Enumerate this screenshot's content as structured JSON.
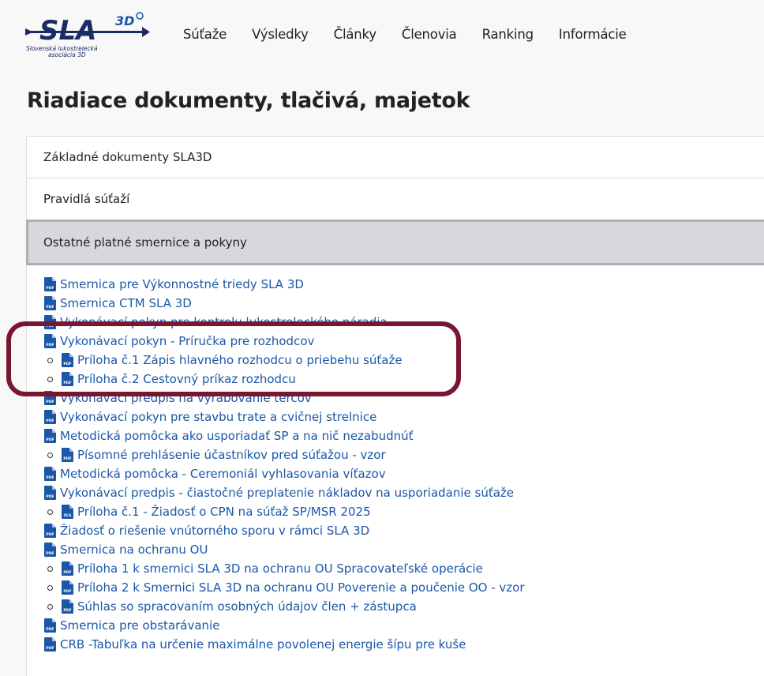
{
  "brand": {
    "logo_text": "SLA",
    "logo_superscript": "3D",
    "tagline_line1": "Slovenská lukostrelecká",
    "tagline_line2": "asociácia 3D",
    "color_primary": "#1a2c63",
    "color_accent": "#1a57a8"
  },
  "nav": {
    "items": [
      "Súťaže",
      "Výsledky",
      "Články",
      "Členovia",
      "Ranking",
      "Informácie"
    ]
  },
  "page": {
    "title": "Riadiace dokumenty, tlačivá, majetok"
  },
  "accordion": {
    "sections": [
      {
        "label": "Základné dokumenty SLA3D",
        "active": false
      },
      {
        "label": "Pravidlá súťaží",
        "active": false
      },
      {
        "label": "Ostatné platné smernice a pokyny",
        "active": true
      }
    ]
  },
  "documents": [
    {
      "label": "Smernica pre Výkonnostné triedy SLA 3D",
      "icon": "pdf-file-icon",
      "sub": false
    },
    {
      "label": "Smernica CTM SLA 3D",
      "icon": "pdf-file-icon",
      "sub": false
    },
    {
      "label": "Vykonávací pokyn pre kontrolu lukostreleckého náradia",
      "icon": "pdf-file-icon",
      "sub": false
    },
    {
      "label": "Vykonávací pokyn - Príručka pre rozhodcov",
      "icon": "pdf-file-icon",
      "sub": false
    },
    {
      "label": "Príloha č.1 Zápis hlavného rozhodcu o priebehu súťaže",
      "icon": "pdf-file-icon",
      "sub": true
    },
    {
      "label": "Príloha č.2 Cestovný príkaz rozhodcu",
      "icon": "pdf-file-icon",
      "sub": true
    },
    {
      "label": "Vykonávací predpis na vyrábovanie terčov",
      "icon": "pdf-file-icon",
      "sub": false
    },
    {
      "label": "Vykonávací pokyn pre stavbu trate a cvičnej strelnice",
      "icon": "pdf-file-icon",
      "sub": false
    },
    {
      "label": "Metodická pomôcka ako usporiadať SP a na nič nezabudnúť",
      "icon": "pdf-file-icon",
      "sub": false
    },
    {
      "label": "Písomné prehlásenie účastníkov pred súťažou - vzor",
      "icon": "pdf-file-icon",
      "sub": true
    },
    {
      "label": "Metodická pomôcka - Ceremoniál vyhlasovania víťazov",
      "icon": "pdf-file-icon",
      "sub": false
    },
    {
      "label": "Vykonávací predpis - čiastočné preplatenie nákladov na usporiadanie súťaže",
      "icon": "pdf-file-icon",
      "sub": false
    },
    {
      "label": "Príloha č.1 - Žiadosť o CPN na súťaž SP/MSR 2025",
      "icon": "xls-file-icon",
      "sub": true
    },
    {
      "label": "Žiadosť o riešenie vnútorného sporu v rámci SLA 3D",
      "icon": "pdf-file-icon",
      "sub": false
    },
    {
      "label": "Smernica na ochranu OU",
      "icon": "pdf-file-icon",
      "sub": false
    },
    {
      "label": "Príloha 1 k smernici SLA 3D na ochranu OU Spracovateľské operácie",
      "icon": "pdf-file-icon",
      "sub": true
    },
    {
      "label": "Príloha 2 k Smernici SLA 3D na ochranu OU Poverenie a poučenie OO - vzor",
      "icon": "pdf-file-icon",
      "sub": true
    },
    {
      "label": "Súhlas so spracovaním osobných údajov člen + zástupca",
      "icon": "pdf-file-icon",
      "sub": true
    },
    {
      "label": "Smernica pre obstarávanie",
      "icon": "pdf-file-icon",
      "sub": false
    },
    {
      "label": "CRB -Tabuľka na určenie maximálne povolenej energie šípu pre kuše",
      "icon": "pdf-file-icon",
      "sub": false
    }
  ],
  "icon_labels": {
    "pdf": "PDF",
    "xls": "XLS"
  },
  "highlight_color": "#7a1730"
}
